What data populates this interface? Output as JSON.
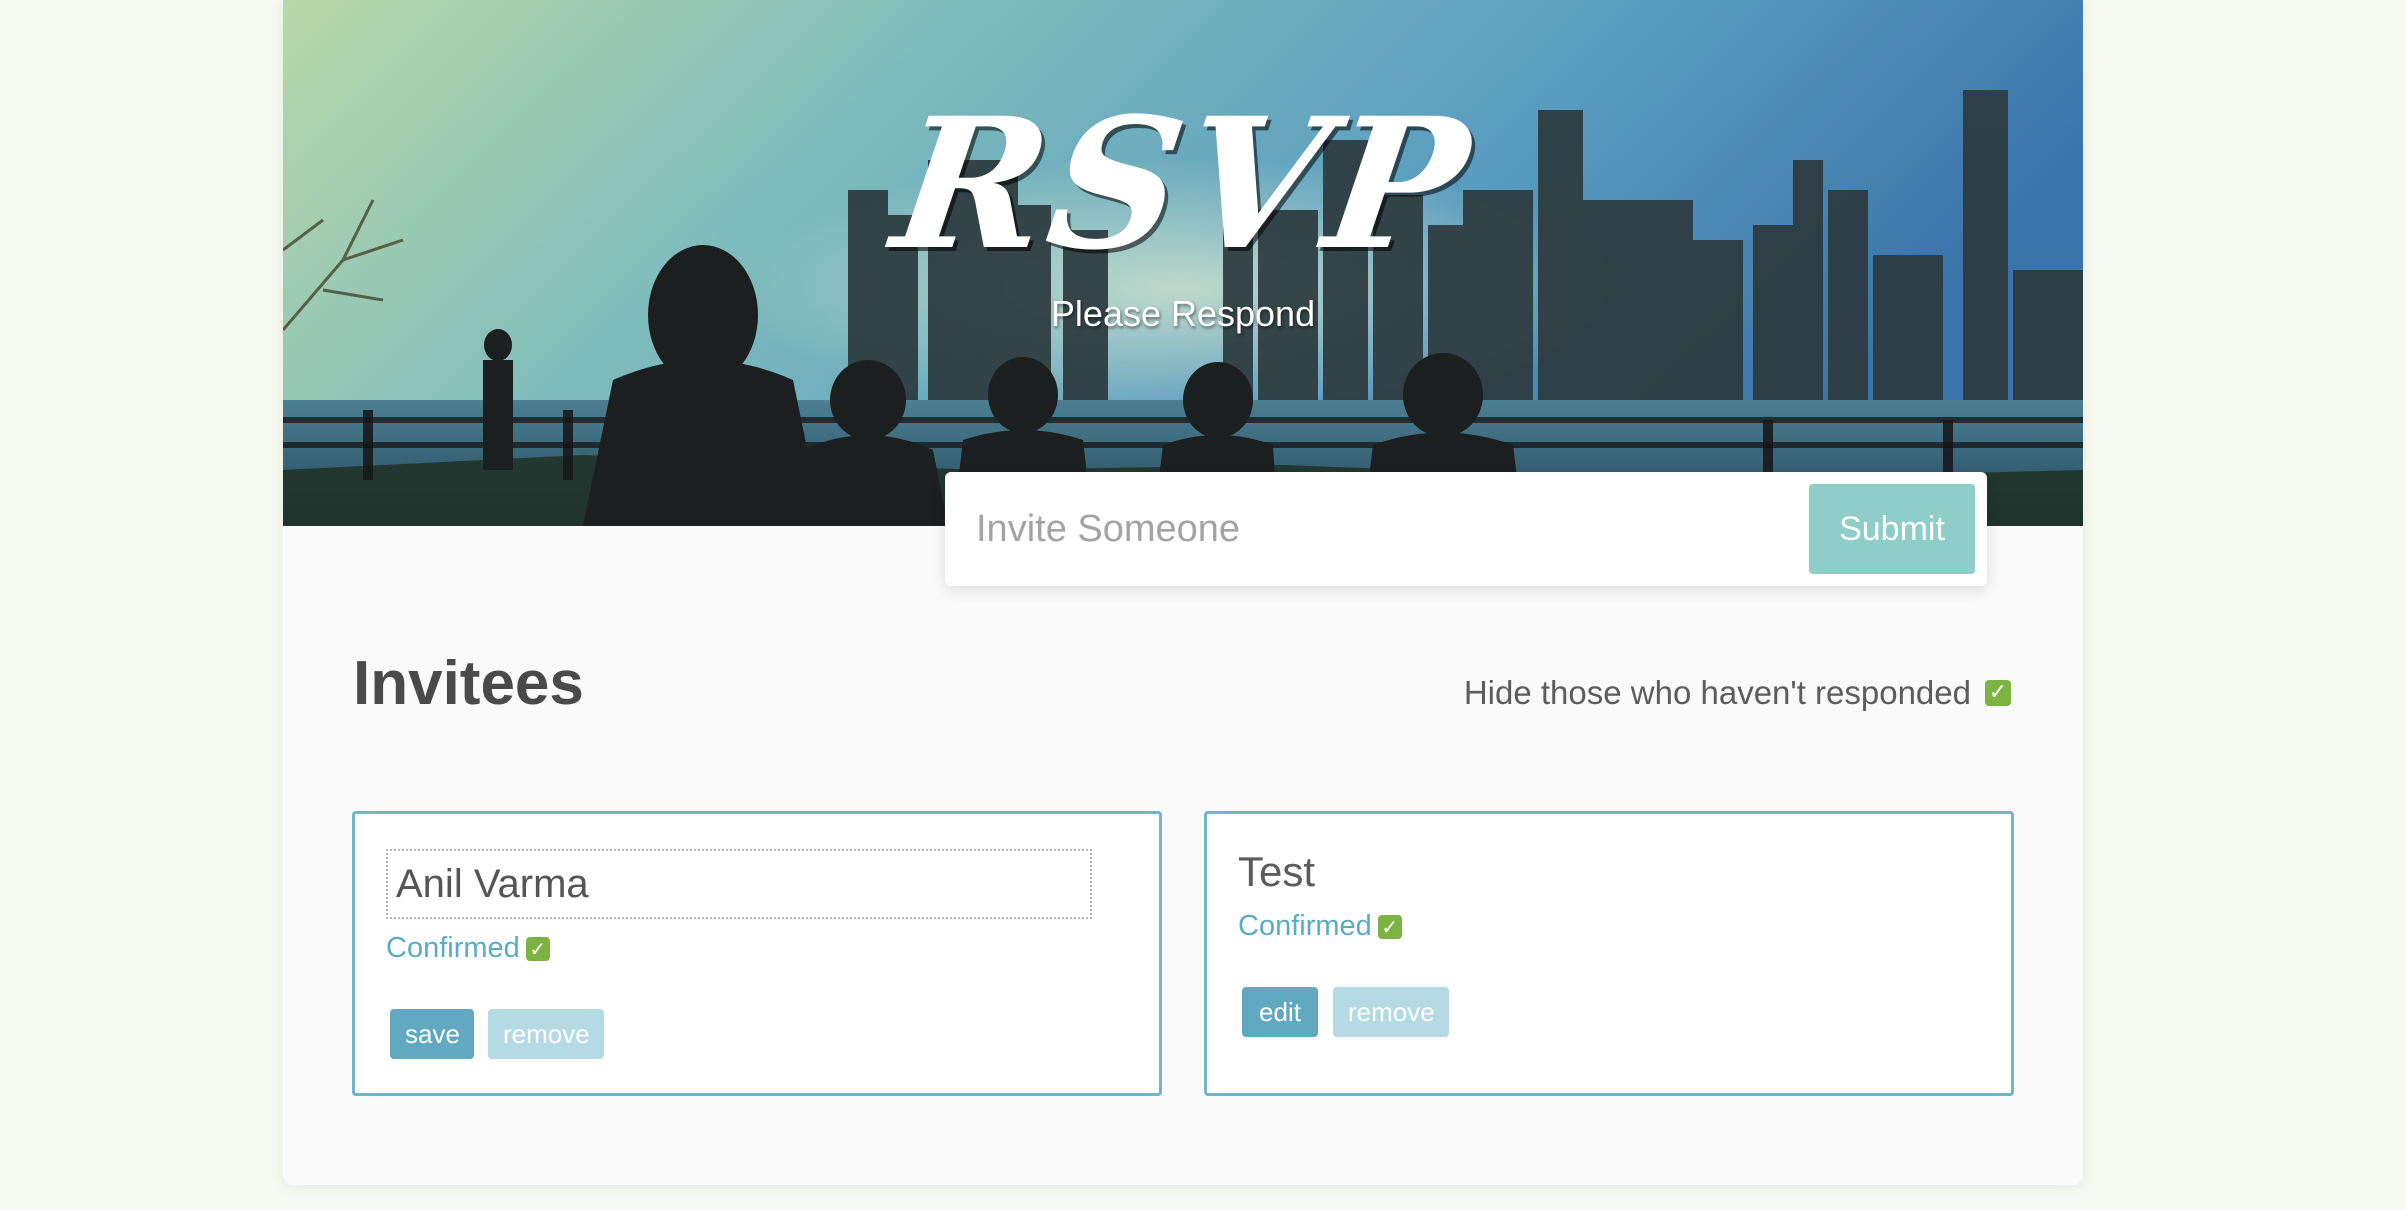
{
  "header": {
    "title": "RSVP",
    "subtitle": "Please Respond"
  },
  "invite_form": {
    "placeholder": "Invite Someone",
    "value": "",
    "submit_label": "Submit"
  },
  "invitees_section": {
    "title": "Invitees",
    "filter_label": "Hide those who haven't responded",
    "filter_checked": true
  },
  "invitees": [
    {
      "name": "Anil Varma",
      "editing": true,
      "status_label": "Confirmed",
      "confirmed": true,
      "primary_action": "save",
      "secondary_action": "remove"
    },
    {
      "name": "Test",
      "editing": false,
      "status_label": "Confirmed",
      "confirmed": true,
      "primary_action": "edit",
      "secondary_action": "remove"
    }
  ],
  "colors": {
    "accent": "#8ecdc8",
    "card_border": "#6fb6cc",
    "confirmed_text": "#5aabc6",
    "checkbox": "#7cb342",
    "primary_button": "#61a9c1",
    "muted_button": "#b4dbe3"
  },
  "icons": {
    "checkbox_checked": "check-icon"
  }
}
